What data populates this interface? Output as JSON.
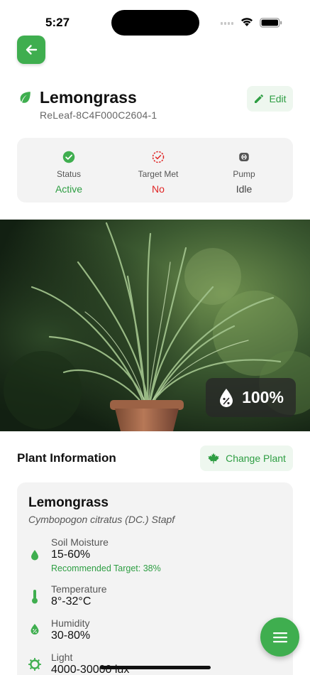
{
  "status_bar": {
    "time": "5:27"
  },
  "header": {
    "title": "Lemongrass",
    "device_id": "ReLeaf-8C4F000C2604-1",
    "edit_label": "Edit"
  },
  "status": {
    "items": [
      {
        "label": "Status",
        "value": "Active",
        "color": "#2e9e43",
        "icon": "check-circle-icon"
      },
      {
        "label": "Target Met",
        "value": "No",
        "color": "#e02424",
        "icon": "target-dashed-check-icon"
      },
      {
        "label": "Pump",
        "value": "Idle",
        "color": "#444444",
        "icon": "pump-icon"
      }
    ]
  },
  "hero": {
    "moisture_value": "100%",
    "icon": "water-percent-icon"
  },
  "plant_info": {
    "section_title": "Plant Information",
    "change_label": "Change Plant",
    "name": "Lemongrass",
    "scientific_name": "Cymbopogon citratus (DC.) Stapf",
    "requirements": [
      {
        "label": "Soil Moisture",
        "value": "15-60%",
        "note": "Recommended Target: 38%",
        "icon": "water-drop-icon"
      },
      {
        "label": "Temperature",
        "value": "8°-32°C",
        "icon": "thermometer-icon"
      },
      {
        "label": "Humidity",
        "value": "30-80%",
        "icon": "humidity-icon"
      },
      {
        "label": "Light",
        "value": "4000-30000 lux",
        "icon": "sun-icon"
      }
    ]
  },
  "colors": {
    "accent": "#3fae4f",
    "accent_text": "#2e9e43",
    "accent_soft": "#eef7ef",
    "card_bg": "#f3f3f3",
    "danger": "#e02424"
  }
}
